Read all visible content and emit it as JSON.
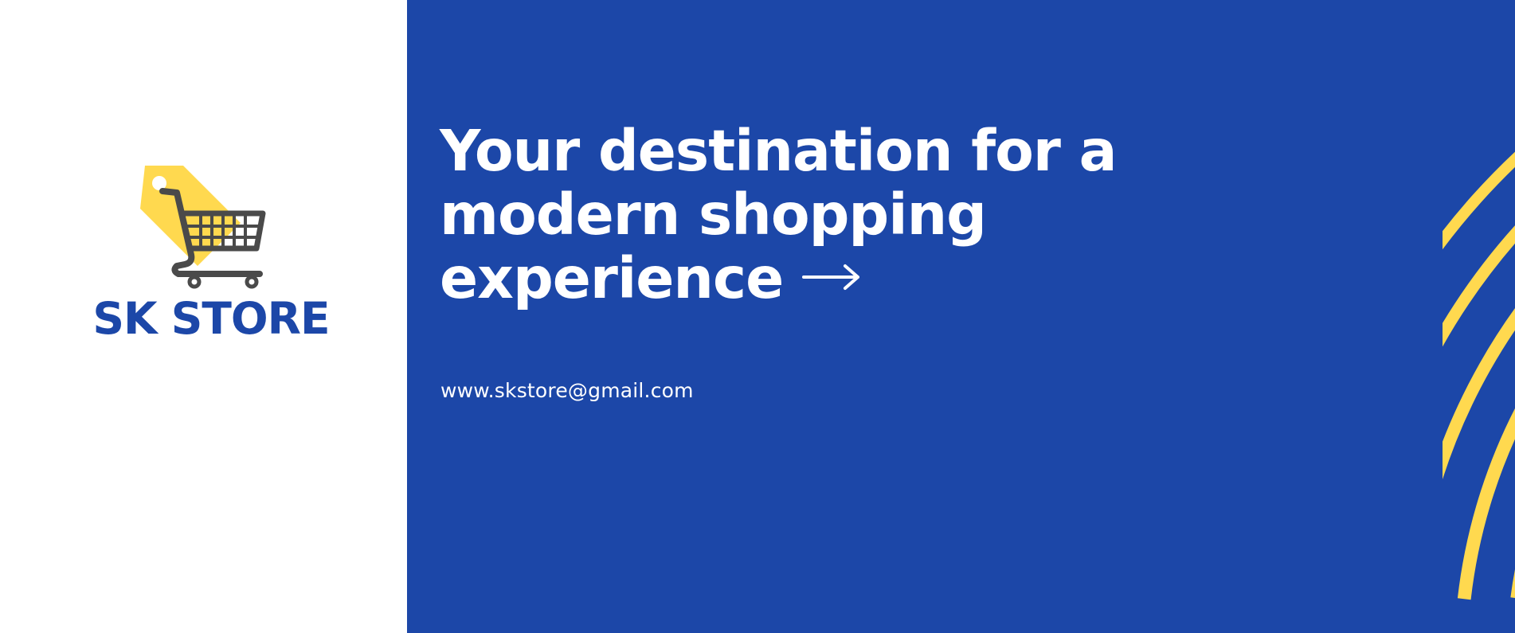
{
  "colors": {
    "background_blue": "#1c47a8",
    "accent_yellow": "#ffd94f",
    "brand_blue": "#1c47a8",
    "cart_gray": "#4a4a4a",
    "white": "#ffffff"
  },
  "brand": {
    "name": "SK STORE",
    "logo_icon": "shopping-cart-tag-icon"
  },
  "hero": {
    "headline_line1": "Your destination for a",
    "headline_line2": "modern shopping",
    "headline_line3": "experience",
    "arrow_icon": "right-arrow-icon"
  },
  "contact": {
    "email": "www.skstore@gmail.com"
  }
}
